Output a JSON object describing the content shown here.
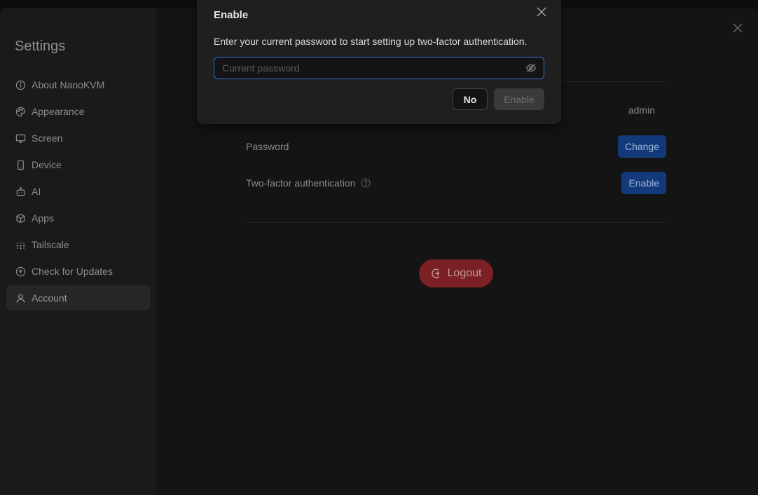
{
  "sidebar": {
    "title": "Settings",
    "items": [
      {
        "label": "About NanoKVM",
        "icon": "info-icon",
        "active": false
      },
      {
        "label": "Appearance",
        "icon": "palette-icon",
        "active": false
      },
      {
        "label": "Screen",
        "icon": "monitor-icon",
        "active": false
      },
      {
        "label": "Device",
        "icon": "smartphone-icon",
        "active": false
      },
      {
        "label": "AI",
        "icon": "bot-icon",
        "active": false
      },
      {
        "label": "Apps",
        "icon": "package-icon",
        "active": false
      },
      {
        "label": "Tailscale",
        "icon": "tailscale-icon",
        "active": false
      },
      {
        "label": "Check for Updates",
        "icon": "arrow-up-circle-icon",
        "active": false
      },
      {
        "label": "Account",
        "icon": "user-icon",
        "active": true
      }
    ]
  },
  "account": {
    "username_value": "admin",
    "password_label": "Password",
    "change_button": "Change",
    "twofa_label": "Two-factor authentication",
    "twofa_button": "Enable",
    "logout_button": "Logout"
  },
  "modal": {
    "title": "Enable",
    "description": "Enter your current password to start setting up two-factor authentication.",
    "password_placeholder": "Current password",
    "password_value": "",
    "no_button": "No",
    "enable_button": "Enable"
  },
  "colors": {
    "primary": "#123a7a",
    "danger": "#7b2024",
    "focus": "#2f6fdc"
  }
}
